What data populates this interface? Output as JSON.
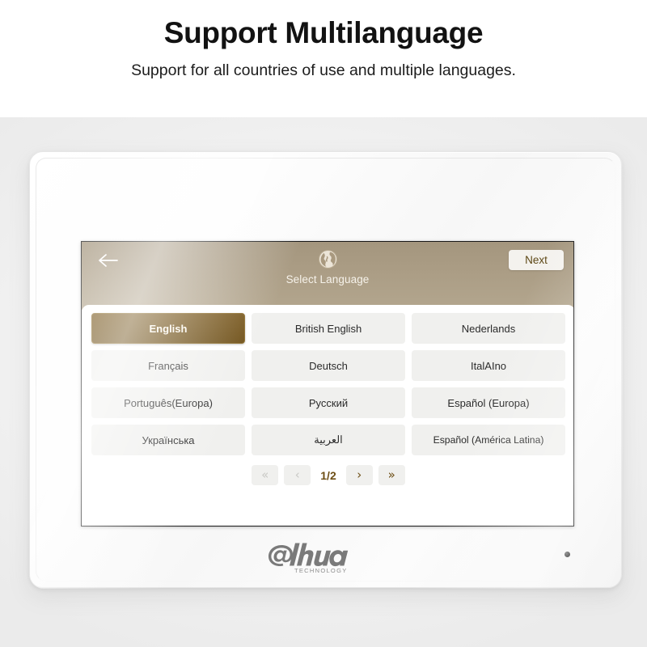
{
  "banner": {
    "title": "Support Multilanguage",
    "subtitle": "Support for all countries of use and multiple languages."
  },
  "device": {
    "brand_name": "alhua",
    "brand_tagline": "TECHNOLOGY",
    "sensor_name": "sensor-dot"
  },
  "screen": {
    "header": {
      "back_icon": "back-arrow-icon",
      "globe_icon": "globe-icon",
      "title": "Select Language",
      "next_label": "Next"
    },
    "languages": [
      {
        "label": "English",
        "selected": true
      },
      {
        "label": "British English",
        "selected": false
      },
      {
        "label": "Nederlands",
        "selected": false
      },
      {
        "label": "Français",
        "selected": false
      },
      {
        "label": "Deutsch",
        "selected": false
      },
      {
        "label": "ItalAIno",
        "selected": false
      },
      {
        "label": "Português(Europa)",
        "selected": false
      },
      {
        "label": "Русский",
        "selected": false
      },
      {
        "label": "Español (Europa)",
        "selected": false
      },
      {
        "label": "Українська",
        "selected": false
      },
      {
        "label": "العربية",
        "selected": false
      },
      {
        "label": "Español (América Latina)",
        "selected": false
      }
    ],
    "pagination": {
      "first_label": "«",
      "prev_label": "‹",
      "page_label": "1/2",
      "next_label": "›",
      "last_label": "»",
      "first_disabled": true,
      "prev_disabled": true,
      "next_disabled": false,
      "last_disabled": false
    }
  },
  "colors": {
    "header_brown": "#ab9d85",
    "selected_brown": "#6d4e15",
    "accent_text": "#6d4e15",
    "button_gray": "#f0f0ee",
    "page_bg": "#ffffff"
  }
}
